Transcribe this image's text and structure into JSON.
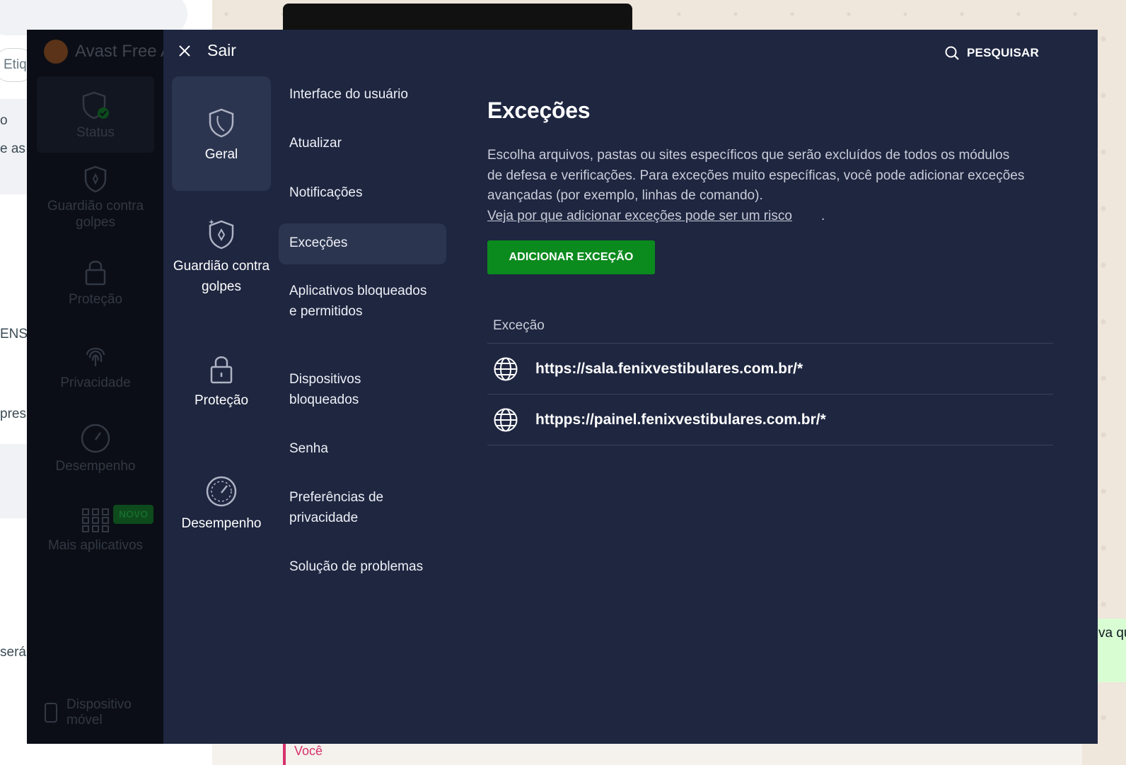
{
  "background": {
    "tag_field_text": "Etiq",
    "left_snippets": [
      "o",
      "e as",
      "ENS",
      "pres",
      "será"
    ],
    "bubble_text": "va qu",
    "you_label": "Você"
  },
  "avast_sidebar": {
    "app_title": "Avast Free A",
    "items": [
      {
        "label": "Status",
        "icon": "shield-check-icon"
      },
      {
        "label": "Guardião contra golpes",
        "icon": "shield-star-icon"
      },
      {
        "label": "Proteção",
        "icon": "lock-icon"
      },
      {
        "label": "Privacidade",
        "icon": "fingerprint-icon"
      },
      {
        "label": "Desempenho",
        "icon": "speedometer-icon"
      },
      {
        "label": "Mais aplicativos",
        "icon": "grid-icon",
        "badge": "NOVO"
      }
    ],
    "mobile_label": "Dispositivo móvel"
  },
  "settings": {
    "exit_label": "Sair",
    "search_label": "PESQUISAR",
    "categories": [
      {
        "label": "Geral",
        "icon": "shield-icon",
        "active": true
      },
      {
        "label": "Guardião contra golpes",
        "icon": "shield-star-icon",
        "active": false
      },
      {
        "label": "Proteção",
        "icon": "lock-icon",
        "active": false
      },
      {
        "label": "Desempenho",
        "icon": "speedometer-icon",
        "active": false
      }
    ],
    "subsections": [
      {
        "label": "Interface do usuário"
      },
      {
        "label": "Atualizar"
      },
      {
        "label": "Notificações"
      },
      {
        "label": "Exceções",
        "active": true
      },
      {
        "label": "Aplicativos bloqueados e permitidos"
      },
      {
        "label": "Dispositivos bloqueados"
      },
      {
        "label": "Senha"
      },
      {
        "label": "Preferências de privacidade"
      },
      {
        "label": "Solução de problemas"
      }
    ]
  },
  "content": {
    "title": "Exceções",
    "description": "Escolha arquivos, pastas ou sites específicos que serão excluídos de todos os módulos de defesa e verificações. Para exceções muito específicas, você pode adicionar exceções avançadas (por exemplo, linhas de comando).",
    "risk_link": "Veja por que adicionar exceções pode ser um risco",
    "risk_link_suffix": ".",
    "add_button": "ADICIONAR EXCEÇÃO",
    "table_header": "Exceção",
    "exceptions": [
      {
        "url": "https://sala.fenixvestibulares.com.br/*",
        "icon": "globe-icon"
      },
      {
        "url": "httpps://painel.fenixvestibulares.com.br/*",
        "icon": "globe-icon"
      }
    ]
  },
  "colors": {
    "panel_bg": "#1e2640",
    "sidebar_bg": "#0b0e16",
    "active_item_bg": "#2c3550",
    "accent_green": "#0b8a1e"
  }
}
